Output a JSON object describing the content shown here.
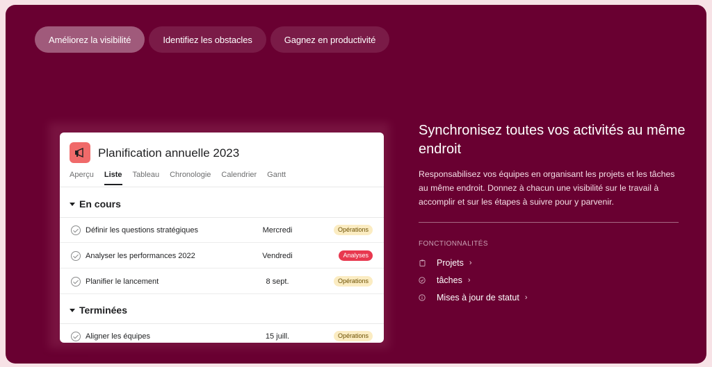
{
  "tabs": [
    {
      "label": "Améliorez la visibilité",
      "active": true
    },
    {
      "label": "Identifiez les obstacles",
      "active": false
    },
    {
      "label": "Gagnez en productivité",
      "active": false
    }
  ],
  "card": {
    "title": "Planification annuelle 2023",
    "icon": "megaphone-icon",
    "views": [
      "Aperçu",
      "Liste",
      "Tableau",
      "Chronologie",
      "Calendrier",
      "Gantt"
    ],
    "active_view": "Liste",
    "sections": [
      {
        "name": "En cours",
        "rows": [
          {
            "name": "Définir les questions stratégiques",
            "date": "Mercredi",
            "tag": "Opérations"
          },
          {
            "name": "Analyser les performances 2022",
            "date": "Vendredi",
            "tag": "Analyses"
          },
          {
            "name": "Planifier le lancement",
            "date": "8 sept.",
            "tag": "Opérations"
          }
        ]
      },
      {
        "name": "Terminées",
        "rows": [
          {
            "name": "Aligner les équipes",
            "date": "15 juill.",
            "tag": "Opérations"
          }
        ]
      }
    ]
  },
  "headline": "Synchronisez toutes vos activités au même endroit",
  "description": "Responsabilisez vos équipes en organisant les projets et les tâches au même endroit. Donnez à chacun une visibilité sur le travail à accomplir et sur les étapes à suivre pour y parvenir.",
  "features_label": "FONCTIONNALITÉS",
  "features": [
    {
      "label": "Projets",
      "icon": "clipboard-icon"
    },
    {
      "label": "tâches",
      "icon": "check-circle-icon"
    },
    {
      "label": "Mises à jour de statut",
      "icon": "info-circle-icon"
    }
  ],
  "colors": {
    "panel": "#690031",
    "tab": "#7a1b47",
    "tab_active": "#a05a7b",
    "project_icon": "#f06a6a",
    "tag_operations": "#fbecc2",
    "tag_analyses": "#e8384f"
  }
}
